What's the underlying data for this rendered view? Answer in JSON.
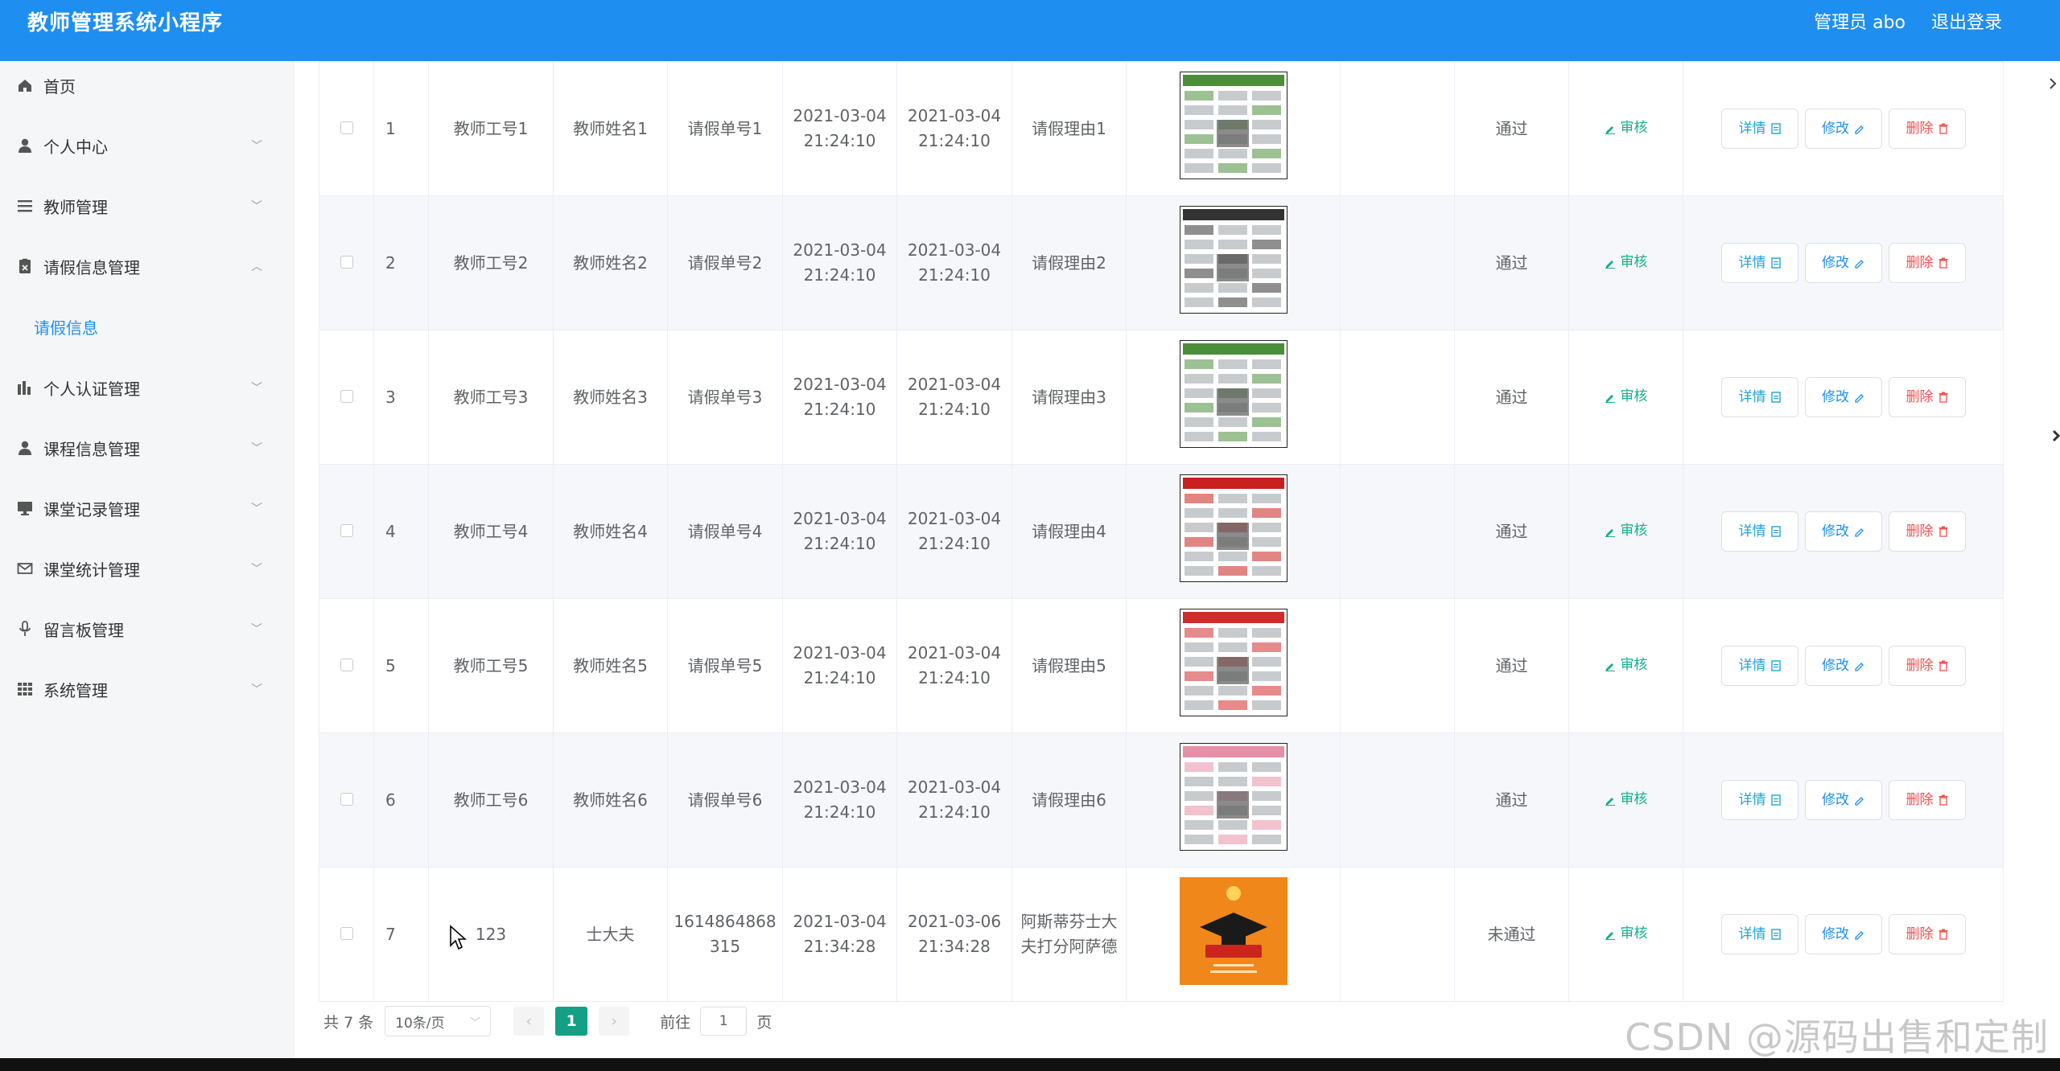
{
  "header": {
    "title": "教师管理系统小程序",
    "user": "管理员 abo",
    "logout": "退出登录"
  },
  "sidebar": {
    "items": [
      {
        "label": "首页",
        "icon": "home-icon"
      },
      {
        "label": "个人中心",
        "icon": "user-icon"
      },
      {
        "label": "教师管理",
        "icon": "list-icon"
      },
      {
        "label": "请假信息管理",
        "icon": "clipboard-icon"
      },
      {
        "label": "个人认证管理",
        "icon": "bar-chart-icon"
      },
      {
        "label": "课程信息管理",
        "icon": "user-icon"
      },
      {
        "label": "课堂记录管理",
        "icon": "monitor-icon"
      },
      {
        "label": "课堂统计管理",
        "icon": "mail-icon"
      },
      {
        "label": "留言板管理",
        "icon": "mic-icon"
      },
      {
        "label": "系统管理",
        "icon": "grid-icon"
      }
    ],
    "submenu": "请假信息"
  },
  "table": {
    "rows": [
      {
        "no": "1",
        "teacher_id": "教师工号1",
        "teacher_name": "教师姓名1",
        "leave_no": "请假单号1",
        "start_date": "2021-03-04",
        "start_time": "21:24:10",
        "end_date": "2021-03-04",
        "end_time": "21:24:10",
        "reason": "请假理由1",
        "thumb": "newspaper-a",
        "status": "通过"
      },
      {
        "no": "2",
        "teacher_id": "教师工号2",
        "teacher_name": "教师姓名2",
        "leave_no": "请假单号2",
        "start_date": "2021-03-04",
        "start_time": "21:24:10",
        "end_date": "2021-03-04",
        "end_time": "21:24:10",
        "reason": "请假理由2",
        "thumb": "newspaper-b",
        "status": "通过"
      },
      {
        "no": "3",
        "teacher_id": "教师工号3",
        "teacher_name": "教师姓名3",
        "leave_no": "请假单号3",
        "start_date": "2021-03-04",
        "start_time": "21:24:10",
        "end_date": "2021-03-04",
        "end_time": "21:24:10",
        "reason": "请假理由3",
        "thumb": "newspaper-a",
        "status": "通过"
      },
      {
        "no": "4",
        "teacher_id": "教师工号4",
        "teacher_name": "教师姓名4",
        "leave_no": "请假单号4",
        "start_date": "2021-03-04",
        "start_time": "21:24:10",
        "end_date": "2021-03-04",
        "end_time": "21:24:10",
        "reason": "请假理由4",
        "thumb": "newspaper-red",
        "status": "通过"
      },
      {
        "no": "5",
        "teacher_id": "教师工号5",
        "teacher_name": "教师姓名5",
        "leave_no": "请假单号5",
        "start_date": "2021-03-04",
        "start_time": "21:24:10",
        "end_date": "2021-03-04",
        "end_time": "21:24:10",
        "reason": "请假理由5",
        "thumb": "newspaper-dense",
        "status": "通过"
      },
      {
        "no": "6",
        "teacher_id": "教师工号6",
        "teacher_name": "教师姓名6",
        "leave_no": "请假单号6",
        "start_date": "2021-03-04",
        "start_time": "21:24:10",
        "end_date": "2021-03-04",
        "end_time": "21:24:10",
        "reason": "请假理由6",
        "thumb": "newspaper-pink",
        "status": "通过"
      },
      {
        "no": "7",
        "teacher_id": "123",
        "teacher_name": "士大夫",
        "leave_no": "1614864868 315",
        "start_date": "2021-03-04",
        "start_time": "21:34:28",
        "end_date": "2021-03-06",
        "end_time": "21:34:28",
        "reason": "阿斯蒂芬士大夫打分阿萨德",
        "thumb": "graduation",
        "status": "未通过"
      }
    ],
    "audit_label": "审核",
    "detail_label": "详情",
    "edit_label": "修改",
    "delete_label": "删除"
  },
  "pager": {
    "total": "共 7 条",
    "page_size": "10条/页",
    "current": "1",
    "goto_prefix": "前往",
    "goto_value": "1",
    "goto_suffix": "页"
  },
  "watermark": "CSDN @源码出售和定制",
  "colors": {
    "primary": "#1e8ff0",
    "success": "#13b08c",
    "danger": "#f0504f",
    "page_active": "#13a084"
  }
}
